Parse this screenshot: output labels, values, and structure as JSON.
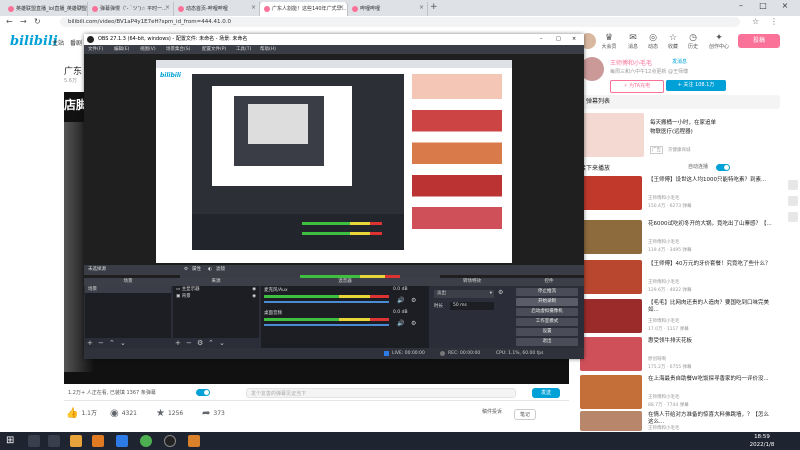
{
  "browser": {
    "tabs": [
      {
        "label": "英雄联盟直播_lol直播_英雄联盟",
        "active": false
      },
      {
        "label": "弹幕弹慢（’- `ツ’)☆ 平时一...",
        "active": false
      },
      {
        "label": "动态首页-哔哩哔哩",
        "active": false
      },
      {
        "label": "广东人割能！这些140年广式早...",
        "active": true
      },
      {
        "label": "哔哩哔哩",
        "active": false
      }
    ],
    "url": "bilibili.com/video/BV1aP4y1E7eH?spm_id_from=444.41.0.0"
  },
  "header": {
    "logo": "bilibili",
    "nav": [
      "主站",
      "番剧"
    ],
    "icons": [
      {
        "label": "大会员",
        "icon": "vip-icon"
      },
      {
        "label": "消息",
        "icon": "message-icon"
      },
      {
        "label": "动态",
        "icon": "dynamic-icon"
      },
      {
        "label": "收藏",
        "icon": "star-icon"
      },
      {
        "label": "历史",
        "icon": "history-icon"
      },
      {
        "label": "创作中心",
        "icon": "lightbulb-icon"
      }
    ],
    "upload": "投稿"
  },
  "video": {
    "title": "广东",
    "meta": "5.6万",
    "overlay": "店脚",
    "online": "1.2万+ 人正在看, 已装填 1367 条弹幕",
    "danmu_placeholder": "发个友善的弹幕见证当下",
    "send": "发送",
    "likes": "1.1万",
    "coins": "4321",
    "favorites": "1256",
    "shares": "373",
    "report": "稿件投诉",
    "note": "笔记"
  },
  "up": {
    "name": "王师傅和小毛毛",
    "tag": "发消息",
    "desc": "每周三和六中午12点更新 @王师傅",
    "charge": "⚡ 为TA充电",
    "follow": "+ 关注 108.1万"
  },
  "danmu_list": "弹幕列表",
  "ad_title": "每天搬桶一小时，在家追单",
  "ad_sub": "物联医疗(远程器)",
  "ad_tag": "广告",
  "ad_store": "京健康商城",
  "next": {
    "label": "接下来播放",
    "autoplay": "自动连播"
  },
  "recs": [
    {
      "title": "【王师傅】设世这人均1000只能特吃素？到素...",
      "author": "王师傅和小毛毛",
      "stats": "150.4万 · 6273 弹幕",
      "color": "#c0392b"
    },
    {
      "title": "花6000试吃初冬开的大锅，竟吃出了山寨感？【...",
      "author": "王师傅和小毛毛",
      "stats": "119.4万 · 3495 弹幕",
      "color": "#8e6b3d"
    },
    {
      "title": "【王师傅】40万元的牙价套餐！究竟吃了些什么？",
      "author": "王师傅和小毛毛",
      "stats": "129.6万 · 4022 弹幕",
      "color": "#b9472f"
    },
    {
      "title": "【毛毛】比网肉还贵的人造肉？要国吃到口味完美如...",
      "author": "王师傅和小毛毛",
      "stats": "17.0万 · 1117 弹幕",
      "color": "#9b2b2b"
    },
    {
      "title": "惠受领牛排天花板",
      "author": "原创呀啊",
      "stats": "175.2万 · 6755 弹幕",
      "color": "#d0505a"
    },
    {
      "title": "在上海最贵自助餐W吃饭探寻香家的吗一评价没...",
      "author": "王师傅和小毛毛",
      "stats": "88.7万 · 7744 弹幕",
      "color": "#c46e3a"
    },
    {
      "title": "在情人节给对方准备的惊喜大料佛跳墙，？【怎么这么...",
      "author": "王师傅和小毛毛",
      "stats": "",
      "color": "#b8866b"
    }
  ],
  "obs": {
    "title": "OBS 27.1.3 (64-bit, windows) - 配置文件: 未命名 - 场景: 未命名",
    "menu": [
      "文件(F)",
      "编辑(E)",
      "视图(V)",
      "场景集合(S)",
      "配置文件(P)",
      "工具(T)",
      "帮助(H)"
    ],
    "scene_label": "未选择源",
    "scene_props": "属性",
    "scene_filter": "滤镜",
    "panels": [
      "场景",
      "来源",
      "混音器",
      "转场特效",
      "控件"
    ],
    "scene_item": "场景",
    "sources": [
      "主显示器",
      "背景"
    ],
    "mixer": [
      {
        "name": "麦克风/Aux",
        "db": "0.0 dB"
      },
      {
        "name": "桌面音频",
        "db": "0.0 dB"
      }
    ],
    "transition": "淡出",
    "duration_label": "时长",
    "duration": "50 ms",
    "controls": [
      "停止推流",
      "开始录制",
      "启动虚拟摄像机",
      "工作室模式",
      "设置",
      "退出"
    ],
    "status": {
      "live": "LIVE: 00:00:00",
      "rec": "REC: 00:00:00",
      "cpu": "CPU: 1.1%, 60.00 fps"
    }
  },
  "clock": {
    "time": "18:59",
    "date": "2022/1/8"
  }
}
